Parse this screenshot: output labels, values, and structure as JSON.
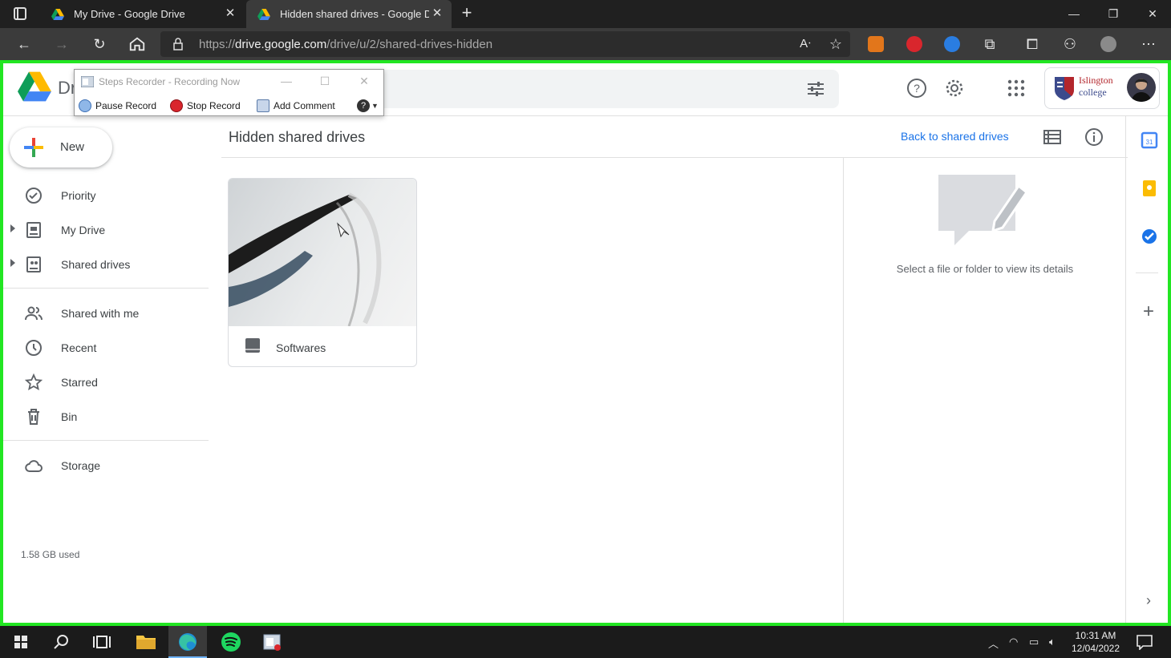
{
  "browser": {
    "tabs": [
      {
        "title": "My Drive - Google Drive"
      },
      {
        "title": "Hidden shared drives - Google D"
      }
    ],
    "url": {
      "prefix": "https://",
      "host": "drive.google.com",
      "path": "/drive/u/2/shared-drives-hidden"
    }
  },
  "steps_recorder": {
    "title": "Steps Recorder - Recording Now",
    "pause_label": "Pause Record",
    "stop_label": "Stop Record",
    "comment_label": "Add Comment"
  },
  "drive": {
    "brand": "Dr",
    "org": {
      "line1": "Islington",
      "line2": "college"
    },
    "new_label": "New",
    "nav": [
      {
        "label": "Priority"
      },
      {
        "label": "My Drive"
      },
      {
        "label": "Shared drives"
      },
      {
        "label": "Shared with me"
      },
      {
        "label": "Recent"
      },
      {
        "label": "Starred"
      },
      {
        "label": "Bin"
      },
      {
        "label": "Storage"
      }
    ],
    "storage_used": "1.58 GB used",
    "page_title": "Hidden shared drives",
    "back_link": "Back to shared drives",
    "drives": [
      {
        "name": "Softwares"
      }
    ],
    "details_message": "Select a file or folder to view its details"
  },
  "taskbar": {
    "time": "10:31 AM",
    "date": "12/04/2022"
  },
  "colors": {
    "recording_frame": "#22e622",
    "link_blue": "#1a73e8",
    "browser_dark": "#202020"
  }
}
